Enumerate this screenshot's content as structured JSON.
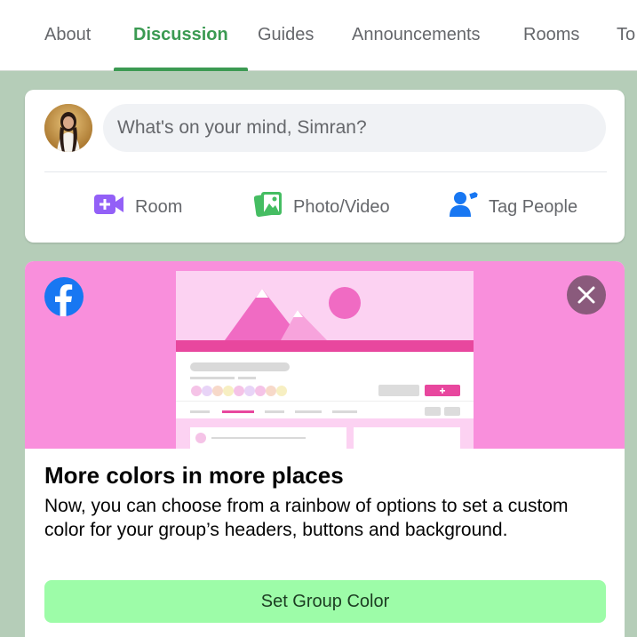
{
  "tabs": [
    {
      "label": "About"
    },
    {
      "label": "Discussion"
    },
    {
      "label": "Guides"
    },
    {
      "label": "Announcements"
    },
    {
      "label": "Rooms"
    },
    {
      "label": "To"
    }
  ],
  "active_tab": "Discussion",
  "composer": {
    "placeholder": "What's on your mind, Simran?",
    "actions": [
      {
        "label": "Room",
        "icon": "video-camera-plus-icon",
        "color": "#9360f7"
      },
      {
        "label": "Photo/Video",
        "icon": "photo-icon",
        "color": "#45bd62"
      },
      {
        "label": "Tag People",
        "icon": "tag-people-icon",
        "color": "#1877f2"
      }
    ]
  },
  "promo": {
    "title": "More colors in more places",
    "body": "Now, you can choose from a rainbow of options to set a custom color for your group’s headers, buttons and background.",
    "button_label": "Set Group Color",
    "banner_color": "#f98fdc",
    "button_color": "#9dfca8"
  },
  "colors": {
    "accent": "#3b9a52",
    "page_background": "#b5cdb8"
  }
}
